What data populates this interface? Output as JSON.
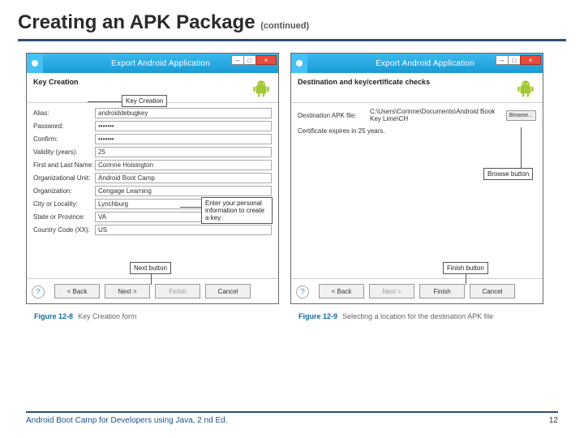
{
  "title_main": "Creating an APK Package",
  "title_cont": "(continued)",
  "footer_text": "Android Boot Camp for Developers using Java, 2 nd Ed.",
  "page_number": "12",
  "dialog_title": "Export Android Application",
  "left": {
    "header_title": "Key Creation",
    "callout_key": "Key Creation",
    "fields": {
      "alias_label": "Alias:",
      "alias_value": "androiddebugkey",
      "password_label": "Password:",
      "password_value": "•••••••",
      "confirm_label": "Confirm:",
      "confirm_value": "•••••••",
      "validity_label": "Validity (years):",
      "validity_value": "25",
      "name_label": "First and Last Name:",
      "name_value": "Corinne Hoisington",
      "ou_label": "Organizational Unit:",
      "ou_value": "Android Boot Camp",
      "org_label": "Organization:",
      "org_value": "Cengage Learning",
      "city_label": "City or Locality:",
      "city_value": "Lynchburg",
      "state_label": "State or Province:",
      "state_value": "VA",
      "country_label": "Country Code (XX):",
      "country_value": "US"
    },
    "callout_info": "Enter your personal information to create a key",
    "callout_next": "Next button",
    "caption_num": "Figure 12-8",
    "caption_text": "Key Creation form"
  },
  "right": {
    "header_title": "Destination and key/certificate checks",
    "dest_label": "Destination APK file:",
    "dest_value": "C:\\Users\\Corinne\\Documents\\Android Book Key Lime\\CH",
    "browse_label": "Browse...",
    "cert_text": "Certificate expires in 25 years.",
    "callout_browse": "Browse button",
    "callout_finish": "Finish button",
    "caption_num": "Figure 12-9",
    "caption_text": "Selecting a location for the destination APK file"
  },
  "buttons": {
    "back": "< Back",
    "next": "Next >",
    "finish": "Finish",
    "cancel": "Cancel"
  }
}
